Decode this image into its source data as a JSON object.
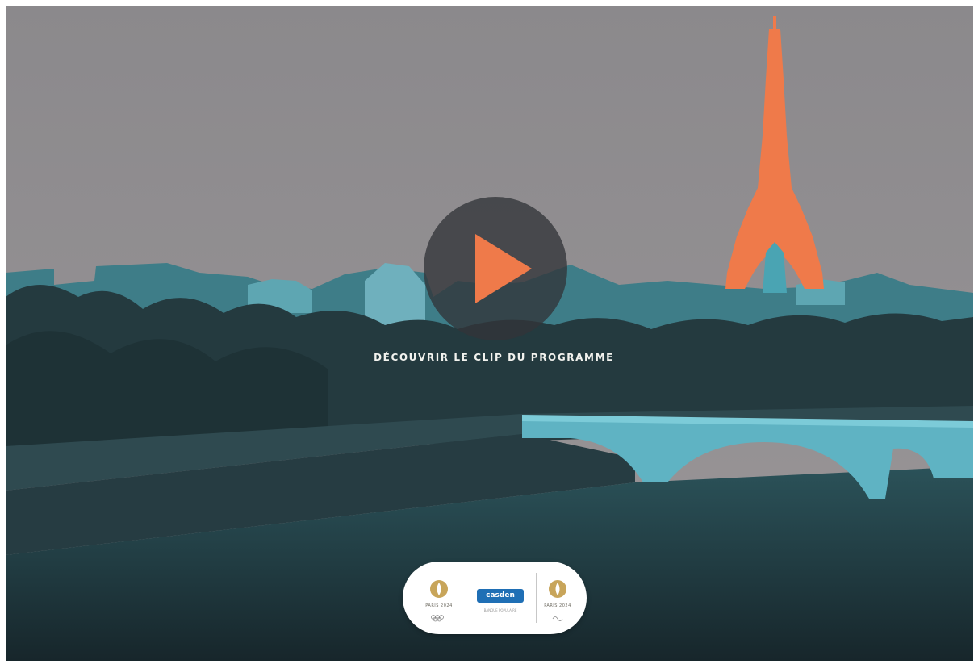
{
  "video": {
    "cta_label": "DÉCOUVRIR LE CLIP DU PROGRAMME",
    "play_icon": "play-icon"
  },
  "partners": {
    "olympic": {
      "name": "PARIS 2024",
      "icon": "olympic-flame-logo"
    },
    "casden": {
      "name": "casden",
      "tagline": "BANQUE POPULAIRE",
      "icon": "casden-logo"
    },
    "paralympic": {
      "name": "PARIS 2024",
      "icon": "paralympic-flame-logo"
    }
  },
  "colors": {
    "sky": "#8f8d8f",
    "teal": "#4fb3c4",
    "dark_teal": "#1f3c44",
    "accent_orange": "#ef7a4a",
    "gold": "#c8a55a"
  }
}
